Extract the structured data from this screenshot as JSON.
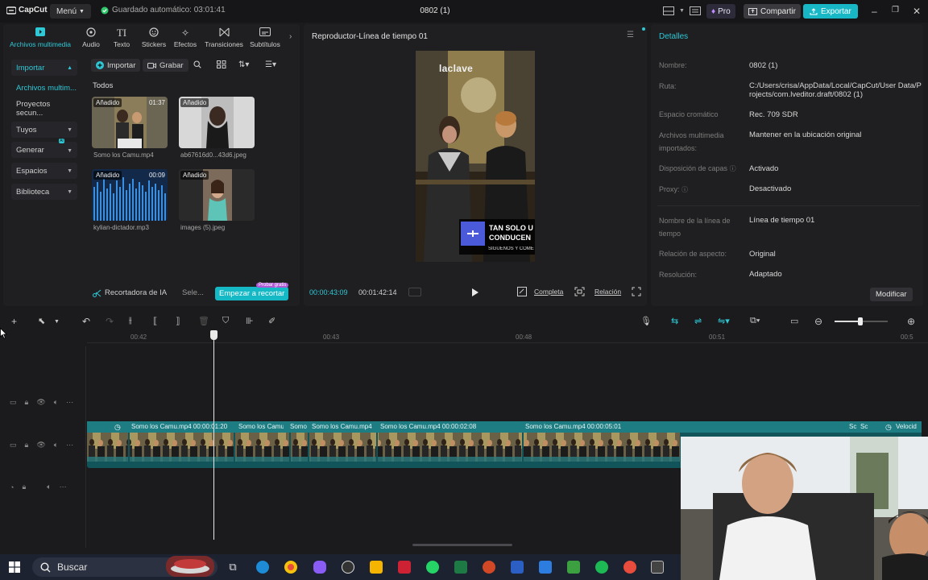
{
  "titlebar": {
    "app_name": "CapCut",
    "menu_label": "Menú",
    "autosave": "Guardado automático: 03:01:41",
    "project_title": "0802 (1)",
    "pro_label": "Pro",
    "share_label": "Compartir",
    "export_label": "Exportar"
  },
  "media_tabs": [
    {
      "label": "Archivos multimedia",
      "icon": "media-icon"
    },
    {
      "label": "Audio",
      "icon": "audio-icon"
    },
    {
      "label": "Texto",
      "icon": "text-icon"
    },
    {
      "label": "Stickers",
      "icon": "sticker-icon"
    },
    {
      "label": "Efectos",
      "icon": "effects-icon"
    },
    {
      "label": "Transiciones",
      "icon": "transitions-icon"
    },
    {
      "label": "Subtítulos",
      "icon": "subtitles-icon"
    }
  ],
  "sidebar": {
    "items": [
      {
        "label": "Importar"
      },
      {
        "label": "Archivos multim..."
      },
      {
        "label": "Proyectos secun..."
      },
      {
        "label": "Tuyos"
      },
      {
        "label": "Generar",
        "badge": "AI"
      },
      {
        "label": "Espacios"
      },
      {
        "label": "Biblioteca"
      }
    ]
  },
  "media": {
    "import_label": "Importar",
    "record_label": "Grabar",
    "filter_label": "Todos",
    "items": [
      {
        "tag": "Añadido",
        "duration": "01:37",
        "name": "Somo los Camu.mp4"
      },
      {
        "tag": "Añadido",
        "duration": "",
        "name": "ab67616d0...43d6.jpeg"
      },
      {
        "tag": "Añadido",
        "duration": "00:09",
        "name": "kylian-dictador.mp3"
      },
      {
        "tag": "Añadido",
        "duration": "",
        "name": "images (5).jpeg"
      }
    ],
    "ai_label": "Recortadora de IA",
    "ai_select": "Sele...",
    "ai_cta": "Empezar a recortar",
    "ai_cta_badge": "Probar gratis"
  },
  "player": {
    "title": "Reproductor-Línea de tiempo 01",
    "video_logo": "laclave",
    "caption_line1": "TAN SOLO U",
    "caption_line2": "CONDUCEN",
    "caption_line3": "SIGUENOS Y COMEN",
    "time_current": "00:00:43:09",
    "time_total": "00:01:42:14",
    "full_label": "Completa",
    "ratio_label": "Relación"
  },
  "details": {
    "title": "Detalles",
    "rows": [
      {
        "key": "Nombre:",
        "value": "0802 (1)"
      },
      {
        "key": "Ruta:",
        "value": "C:/Users/crisa/AppData/Local/CapCut/User Data/Projects/com.lveditor.draft/0802 (1)"
      },
      {
        "key": "Espacio cromático",
        "value": "Rec. 709 SDR"
      },
      {
        "key": "Archivos multimedia importados:",
        "value": "Mantener en la ubicación original"
      },
      {
        "key": "Disposición de capas",
        "value": "Activado"
      },
      {
        "key": "Proxy:",
        "value": "Desactivado"
      },
      {
        "key": "Nombre de la línea de tiempo",
        "value": "Línea de tiempo 01"
      },
      {
        "key": "Relación de aspecto:",
        "value": "Original"
      },
      {
        "key": "Resolución:",
        "value": "Adaptado"
      }
    ],
    "modify_label": "Modificar"
  },
  "timeline": {
    "ruler": [
      "00:42",
      "00:43",
      "00:48",
      "00:51",
      "00:5"
    ],
    "clips": [
      {
        "label": "Somo los Camu.mp4  00:00:01:20"
      },
      {
        "label": "Somo los Camu"
      },
      {
        "label": "Somo"
      },
      {
        "label": "Somo los Camu.mp4"
      },
      {
        "label": "Somo los Camu.mp4  00:00:02:08"
      },
      {
        "label": "Somo los Camu.mp4  00:00:05:01"
      },
      {
        "label": "Sc"
      },
      {
        "label": "Sc"
      },
      {
        "label": "Velocid"
      }
    ]
  },
  "taskbar": {
    "search_placeholder": "Buscar"
  },
  "colors": {
    "accent": "#2ec8d6",
    "export": "#18b7c6",
    "track": "#1d7d82"
  }
}
